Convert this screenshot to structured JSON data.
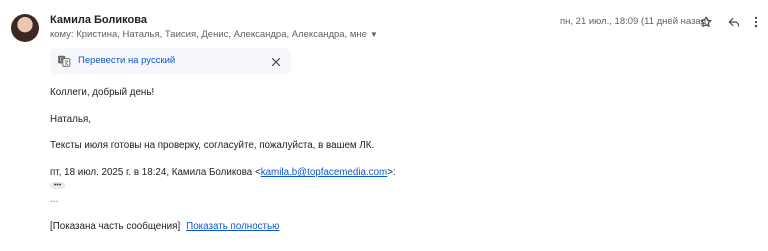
{
  "header": {
    "sender_name": "Камила Боликова",
    "recipients": "кому: Кристина, Наталья, Таисия, Денис, Александра, Александра, мне",
    "date": "пн, 21 июл., 18:09 (11 дней назад)",
    "icons": [
      "star-icon",
      "reply-icon",
      "more-vert-icon"
    ]
  },
  "translate": {
    "link": "Перевести на русский",
    "icons": [
      "translate-icon",
      "close-icon"
    ]
  },
  "body": {
    "greeting": "Коллеги, добрый день!",
    "addressee": "Наталья,",
    "text": "Тексты июля готовы на проверку, согласуйте, пожалуйста, в вашем ЛК.",
    "quote_prefix": "пт, 18 июл. 2025 г. в 18:24, Камила Боликова <",
    "quote_email": "kamila.b@topfacemedia.com",
    "quote_suffix": ">:",
    "dots": "•••",
    "ellipsis": "...",
    "clipped_notice": "[Показана часть сообщения]",
    "show_full": "Показать полностью"
  },
  "colors": {
    "link": "#0b57d0",
    "translate_bg": "#f5f7fb",
    "secondary_text": "#5f6368"
  }
}
